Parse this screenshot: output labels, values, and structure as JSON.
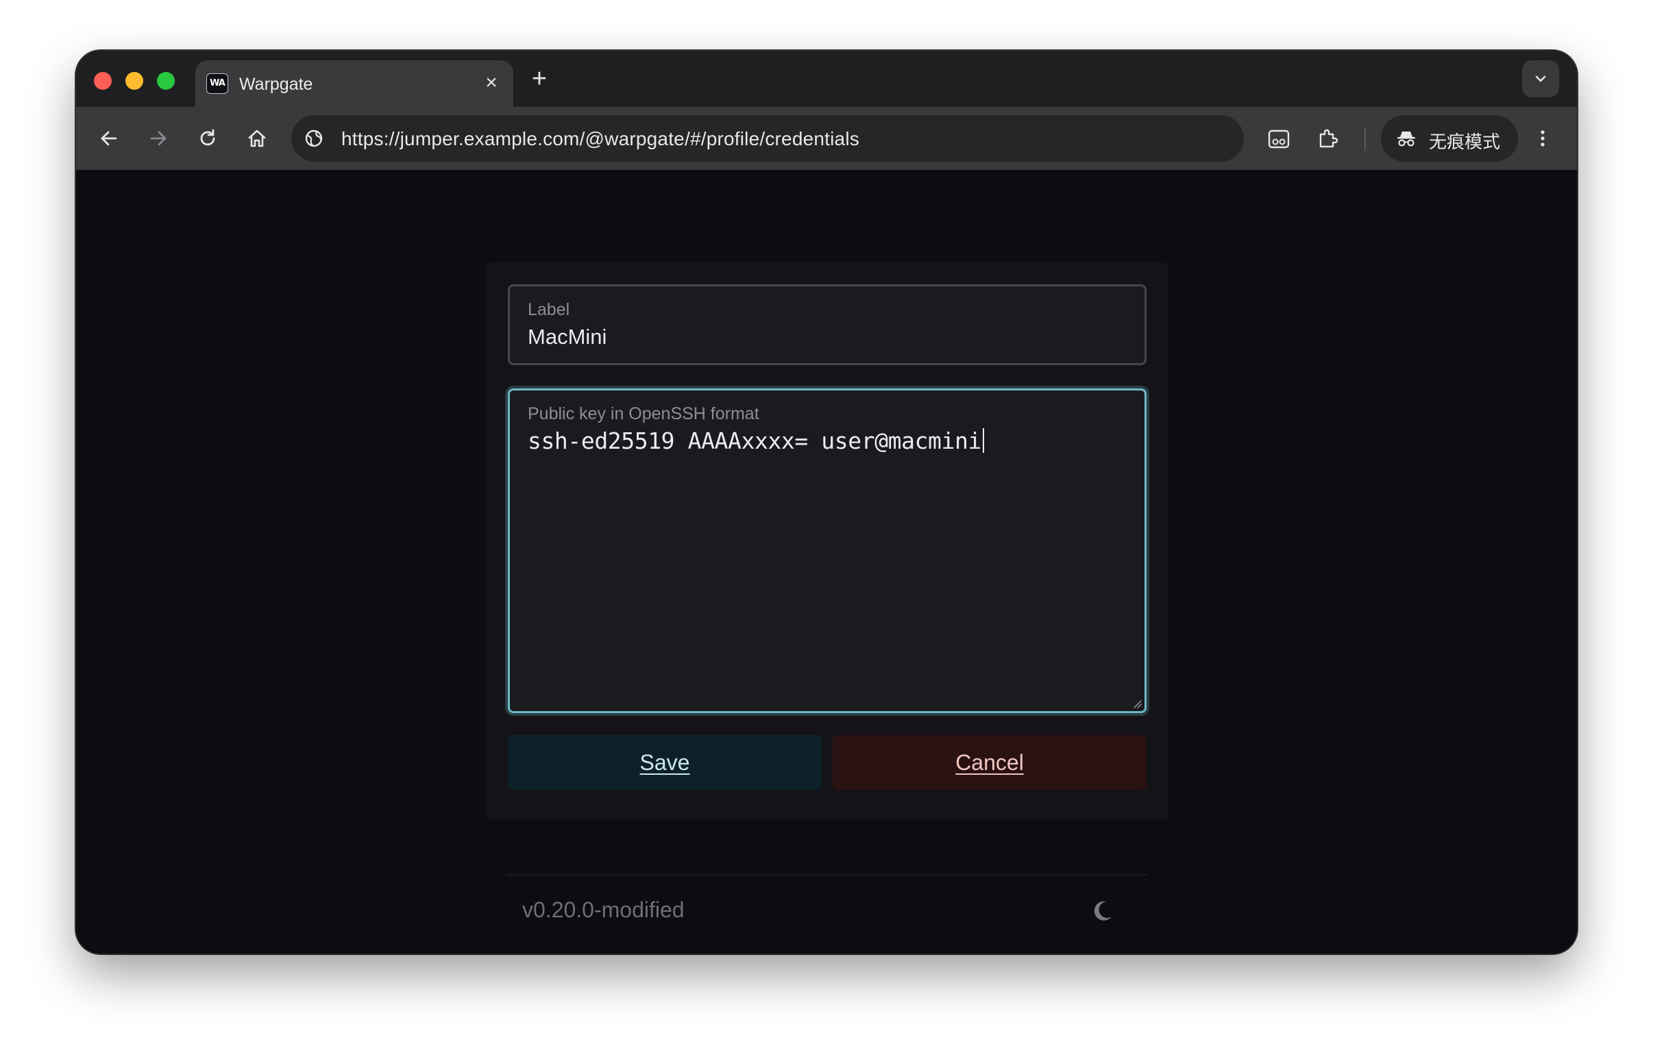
{
  "browser": {
    "tab": {
      "favicon_text": "WA",
      "title": "Warpgate"
    },
    "new_tab_symbol": "+",
    "close_symbol": "×",
    "url": "https://jumper.example.com/@warpgate/#/profile/credentials",
    "incognito_label": "无痕模式"
  },
  "form": {
    "label_field": {
      "label": "Label",
      "value": "MacMini"
    },
    "key_field": {
      "label": "Public key in OpenSSH format",
      "value": "ssh-ed25519 AAAAxxxx= user@macmini"
    },
    "save_label": "Save",
    "cancel_label": "Cancel"
  },
  "footer": {
    "version": "v0.20.0-modified"
  },
  "colors": {
    "accent_focus": "#6cb8c4",
    "save_bg": "#0f2128",
    "cancel_bg": "#2a1213",
    "page_bg": "#0d0c10"
  }
}
